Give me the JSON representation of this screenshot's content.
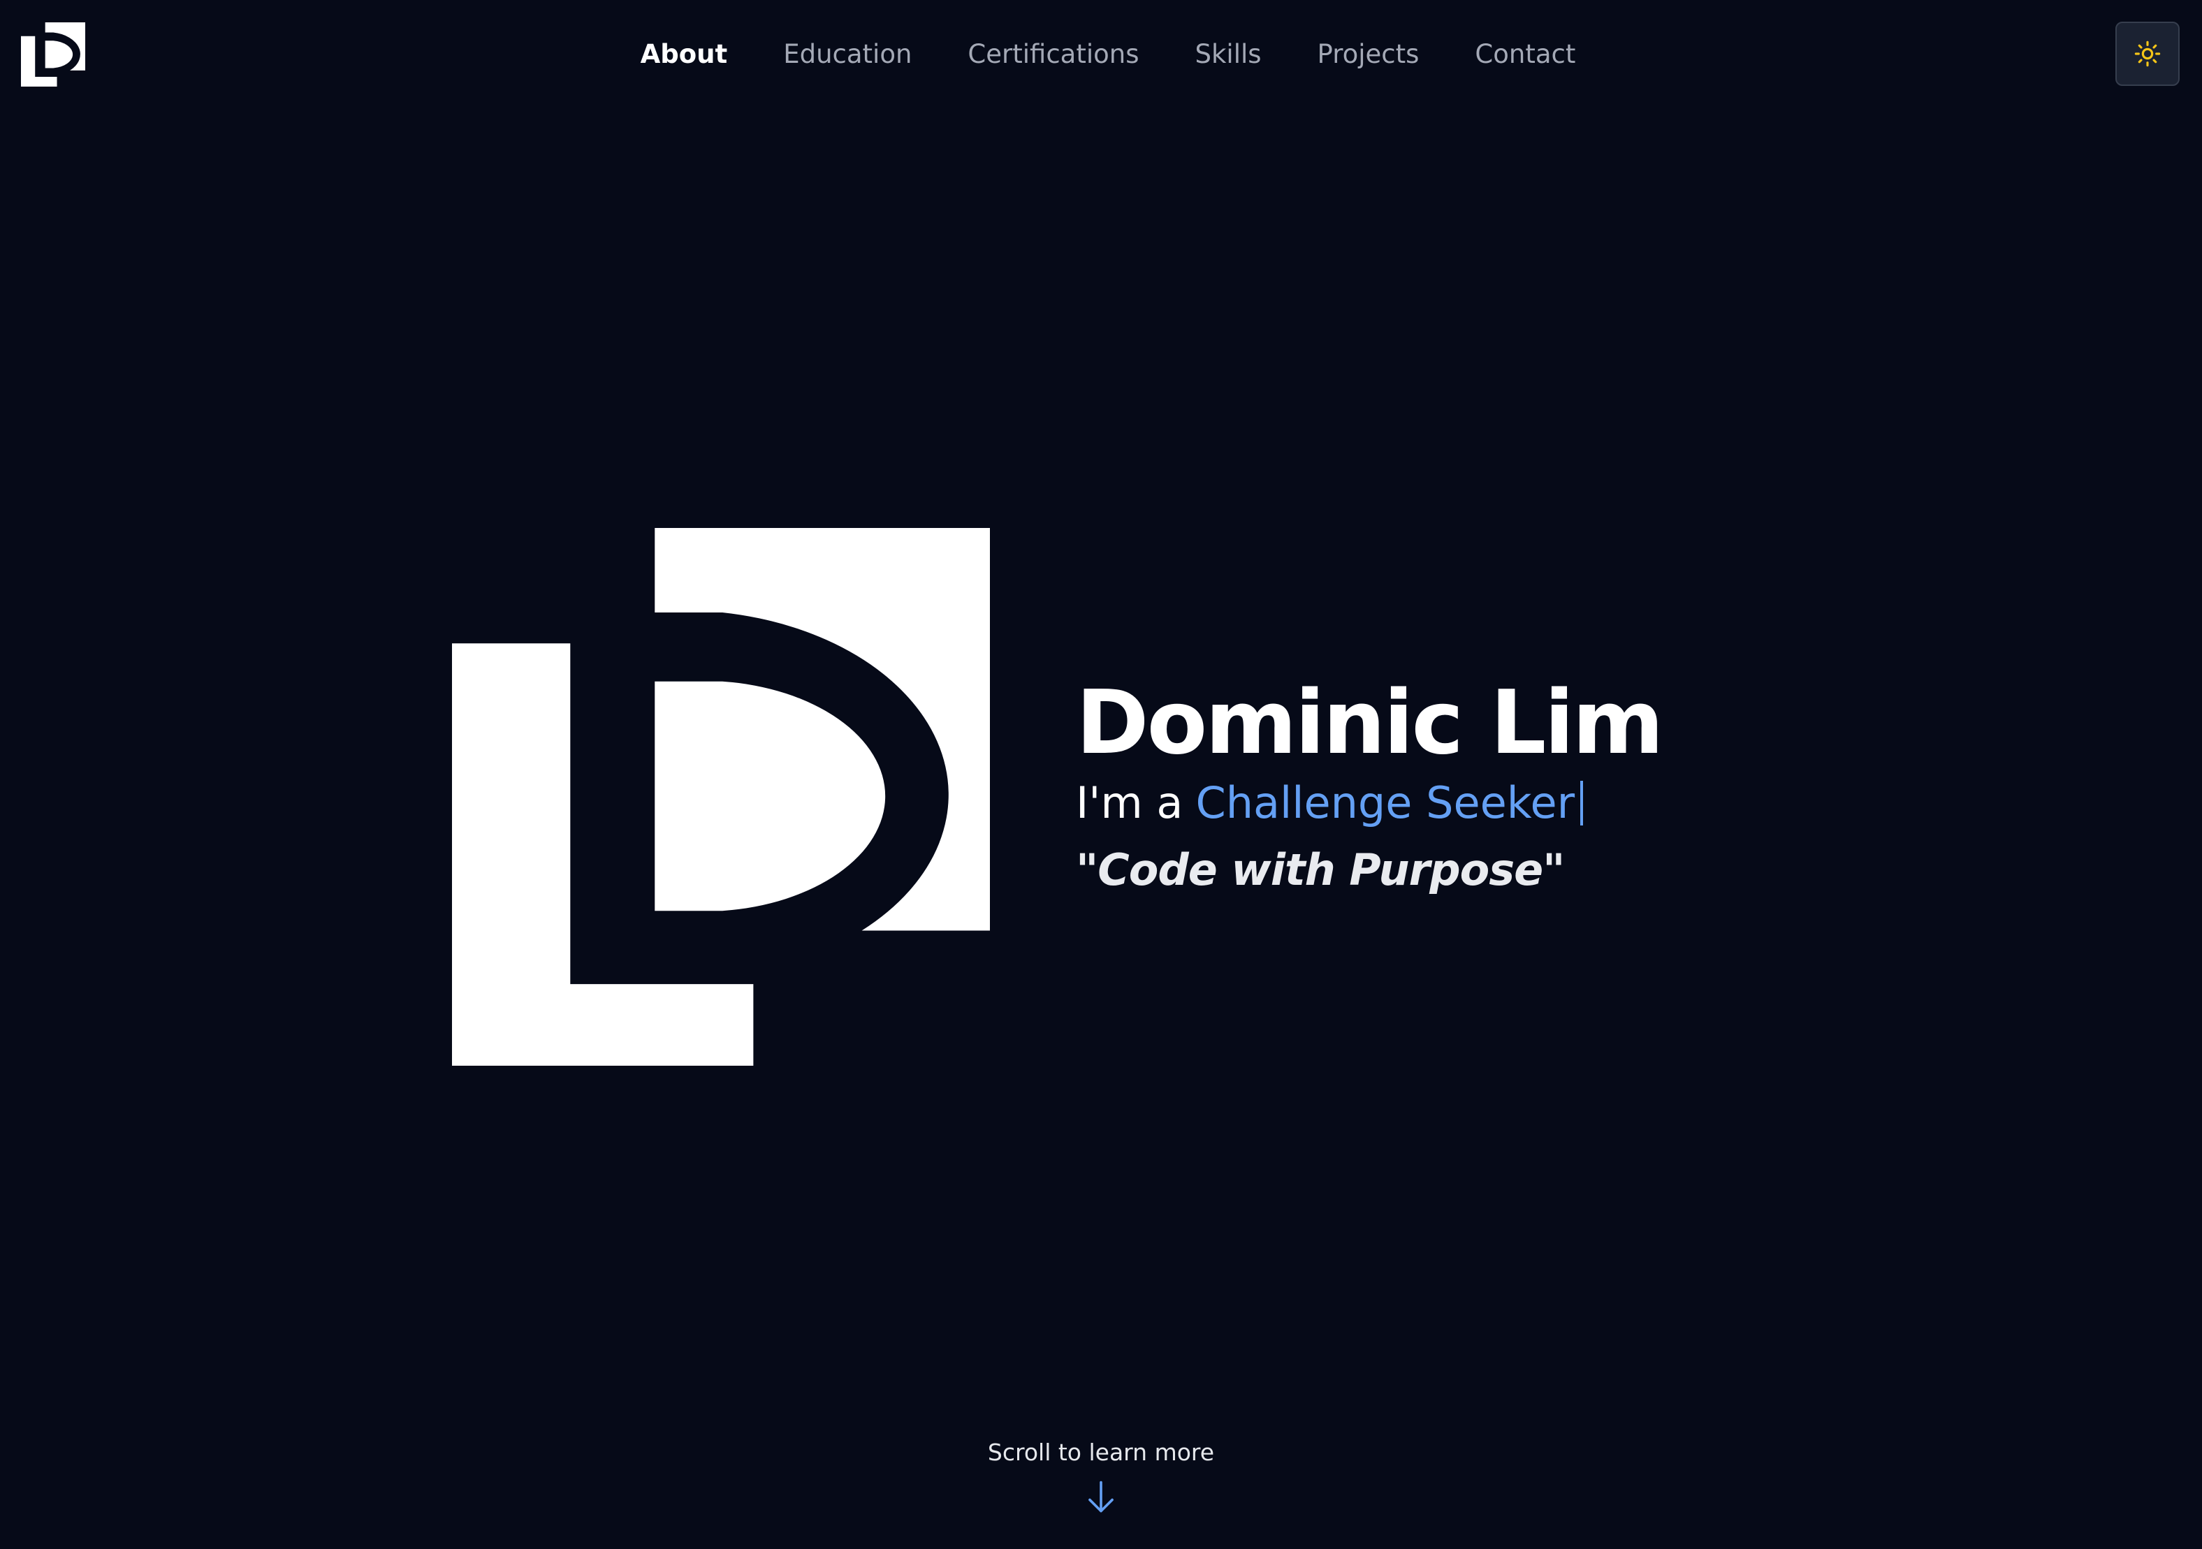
{
  "nav": {
    "items": [
      {
        "label": "About",
        "active": true
      },
      {
        "label": "Education",
        "active": false
      },
      {
        "label": "Certifications",
        "active": false
      },
      {
        "label": "Skills",
        "active": false
      },
      {
        "label": "Projects",
        "active": false
      },
      {
        "label": "Contact",
        "active": false
      }
    ],
    "logo_icon": "ld-monogram-icon",
    "theme_toggle_icon": "sun-icon"
  },
  "hero": {
    "name": "Dominic Lim",
    "tagline_prefix": "I'm a",
    "role": "Challenge Seeker",
    "motto": "\"Code with Purpose\"",
    "logo_icon": "ld-monogram-icon"
  },
  "scroll": {
    "label": "Scroll to learn more",
    "icon": "arrow-down-icon"
  },
  "colors": {
    "background": "#060a18",
    "accent": "#64a0f4",
    "nav_inactive": "#a4a9b6",
    "sun": "#f5c518",
    "toggle_bg": "#1b2232"
  }
}
